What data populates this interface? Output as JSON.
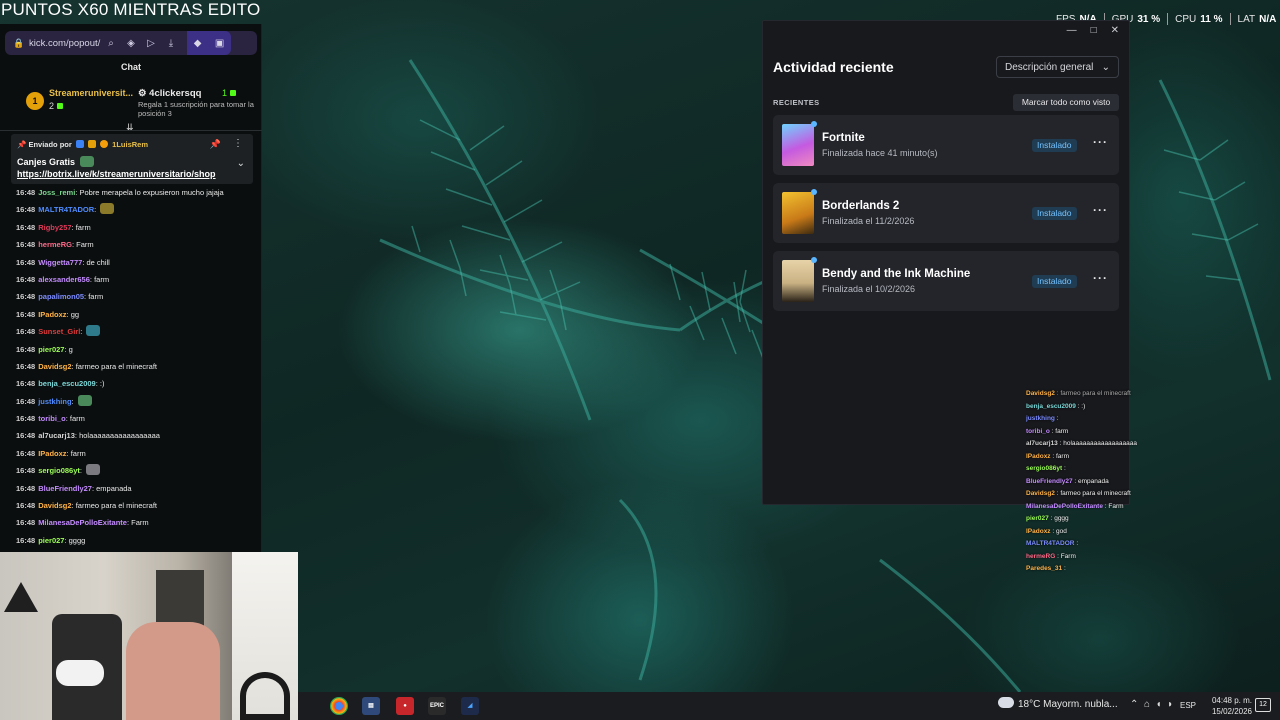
{
  "stream_title": "PUNTOS X60 MIENTRAS EDITO",
  "browser": {
    "url": "kick.com/popout/",
    "icons": [
      "lock-icon",
      "search-icon",
      "shield-icon",
      "play-icon",
      "download-icon",
      "diamond-icon",
      "box-icon"
    ]
  },
  "chat": {
    "header": "Chat",
    "leaderboard": {
      "rank": "1",
      "top_name": "Streameruniversit...",
      "top_count": "2",
      "gift_user": "4clickersqq",
      "gift_count": "1",
      "gift_text": "Regala 1 suscripción para tomar la posición 3"
    },
    "pinned": {
      "sent_by_label": "Enviado por",
      "sent_by_user": "1LuisRem",
      "text": "Canjes Gratis",
      "link": "https://botrix.live/k/streameruniversitario/shop"
    },
    "messages": [
      {
        "time": "16:48",
        "user": "Joss_remi",
        "color": "#7bd88f",
        "text": "Pobre merapela lo expusieron mucho jajaja",
        "emote": ""
      },
      {
        "time": "16:48",
        "user": "MALTR4TADOR",
        "color": "#4f8cff",
        "text": "",
        "emote": "#8a7a2a"
      },
      {
        "time": "16:48",
        "user": "Rigby257",
        "color": "#e23b5a",
        "text": "farm",
        "emote": ""
      },
      {
        "time": "16:48",
        "user": "hermeRG",
        "color": "#ff6b8a",
        "text": "Farm",
        "emote": ""
      },
      {
        "time": "16:48",
        "user": "Wiggetta777",
        "color": "#c48cff",
        "text": "de chill",
        "emote": ""
      },
      {
        "time": "16:48",
        "user": "alexsander656",
        "color": "#c48cff",
        "text": "farm",
        "emote": ""
      },
      {
        "time": "16:48",
        "user": "papalimon05",
        "color": "#7c8cff",
        "text": "farm",
        "emote": ""
      },
      {
        "time": "16:48",
        "user": "IPadoxz",
        "color": "#ffb347",
        "text": "gg",
        "emote": ""
      },
      {
        "time": "16:48",
        "user": "Sunset_Girl",
        "color": "#e23b3b",
        "text": "",
        "emote": "#2f7a8a"
      },
      {
        "time": "16:48",
        "user": "pier027",
        "color": "#9cff57",
        "text": "g",
        "emote": ""
      },
      {
        "time": "16:48",
        "user": "Davidsg2",
        "color": "#ffb347",
        "text": "farmeo para el minecraft",
        "emote": ""
      },
      {
        "time": "16:48",
        "user": "benja_escu2009",
        "color": "#7bd8d8",
        "text": ":)",
        "emote": ""
      },
      {
        "time": "16:48",
        "user": "justkhing",
        "color": "#4f8cff",
        "text": "",
        "emote": "#4a8a5a"
      },
      {
        "time": "16:48",
        "user": "toribi_o",
        "color": "#c48cff",
        "text": "farm",
        "emote": ""
      },
      {
        "time": "16:48",
        "user": "al7ucarj13",
        "color": "#d6d6d6",
        "text": "holaaaaaaaaaaaaaaaaa",
        "emote": ""
      },
      {
        "time": "16:48",
        "user": "IPadoxz",
        "color": "#ffb347",
        "text": "farm",
        "emote": ""
      },
      {
        "time": "16:48",
        "user": "sergio086yt",
        "color": "#9cff57",
        "text": "",
        "emote": "#7a7a80"
      },
      {
        "time": "16:48",
        "user": "BlueFriendly27",
        "color": "#c48cff",
        "text": "empanada",
        "emote": ""
      },
      {
        "time": "16:48",
        "user": "Davidsg2",
        "color": "#ffb347",
        "text": "farmeo para el minecraft",
        "emote": ""
      },
      {
        "time": "16:48",
        "user": "MilanesaDePolloExitante",
        "color": "#c48cff",
        "text": "Farm",
        "emote": ""
      },
      {
        "time": "16:48",
        "user": "pier027",
        "color": "#9cff57",
        "text": "gggg",
        "emote": ""
      }
    ]
  },
  "perf": {
    "fps_label": "FPS",
    "fps_value": "N/A",
    "gpu_label": "GPU",
    "gpu_value": "31 %",
    "cpu_label": "CPU",
    "cpu_value": "11 %",
    "lat_label": "LAT",
    "lat_value": "N/A"
  },
  "activity": {
    "title": "Actividad reciente",
    "filter": "Descripción general",
    "section": "RECIENTES",
    "mark_all": "Marcar todo como visto",
    "games": [
      {
        "name": "Fortnite",
        "status": "Finalizada hace 41 minuto(s)",
        "badge": "Instalado",
        "cover": "linear-gradient(160deg,#6fd3ff,#c45ae0 55%,#f08ac0)"
      },
      {
        "name": "Borderlands 2",
        "status": "Finalizada el 11/2/2026",
        "badge": "Instalado",
        "cover": "linear-gradient(160deg,#f2c230,#c97a18 60%,#3b2a10)"
      },
      {
        "name": "Bendy and the Ink Machine",
        "status": "Finalizada el 10/2/2026",
        "badge": "Instalado",
        "cover": "linear-gradient(180deg,#e7d3a8,#c9b183 55%,#2a2218)"
      }
    ]
  },
  "mini_chat": [
    {
      "user": "Davidsg2",
      "color": "#ffb347",
      "text": "farmeo para el minecraft",
      "cut": true
    },
    {
      "user": "benja_escu2009",
      "color": "#7bd8d8",
      "text": ":)"
    },
    {
      "user": "justkhing",
      "color": "#7c8cff",
      "text": ""
    },
    {
      "user": "toribi_o",
      "color": "#c48cff",
      "text": "farm"
    },
    {
      "user": "al7ucarj13",
      "color": "#d6d6d6",
      "text": "holaaaaaaaaaaaaaaaaaa"
    },
    {
      "user": "IPadoxz",
      "color": "#ffb347",
      "text": "farm"
    },
    {
      "user": "sergio086yt",
      "color": "#9cff57",
      "text": ""
    },
    {
      "user": "BlueFriendly27",
      "color": "#c48cff",
      "text": "empanada"
    },
    {
      "user": "Davidsg2",
      "color": "#ffb347",
      "text": "farmeo para el minecraft"
    },
    {
      "user": "MilanesaDePolloExitante",
      "color": "#c48cff",
      "text": "Farm"
    },
    {
      "user": "pier027",
      "color": "#9cff57",
      "text": "gggg"
    },
    {
      "user": "IPadoxz",
      "color": "#ffb347",
      "text": "god"
    },
    {
      "user": "MALTR4TADOR",
      "color": "#7c8cff",
      "text": ""
    },
    {
      "user": "hermeRG",
      "color": "#ff6b8a",
      "text": "Farm"
    },
    {
      "user": "Paredes_31",
      "color": "#ffb347",
      "text": ""
    }
  ],
  "taskbar": {
    "apps": [
      "chrome",
      "files",
      "obs",
      "epic",
      "vscode"
    ],
    "epic_label": "EPIC",
    "weather": "18°C  Mayorm. nubla...",
    "lang": "ESP",
    "time": "04:48 p. m.",
    "date": "15/02/2026",
    "notifications": "12"
  }
}
